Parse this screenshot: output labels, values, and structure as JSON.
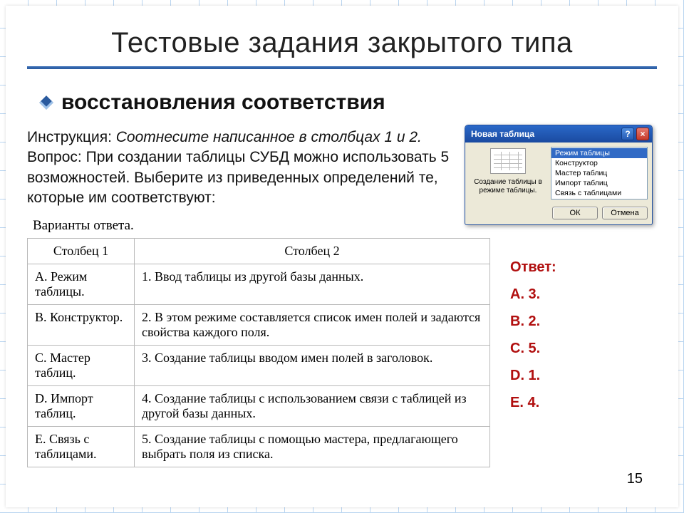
{
  "title": "Тестовые задания закрытого типа",
  "subtitle": "восстановления соответствия",
  "instruction_label": "Инструкция:",
  "instruction_text": "Соотнесите написанное в столбцах 1 и 2.",
  "question_label": "Вопрос:",
  "question_text": "При создании таблицы СУБД можно использовать 5 возможностей. Выберите из приведенных определений те, которые им соответствуют:",
  "variants_label": "Варианты ответа.",
  "table": {
    "head_col1": "Столбец 1",
    "head_col2": "Столбец 2",
    "rows": [
      {
        "c1": "A. Режим таблицы.",
        "c2": "1. Ввод таблицы из другой базы данных."
      },
      {
        "c1": "B. Конструктор.",
        "c2": "2. В этом режиме составляется список имен полей и задаются свойства каждого поля."
      },
      {
        "c1": "C. Мастер таблиц.",
        "c2": "3. Создание таблицы вводом имен полей в заголовок."
      },
      {
        "c1": "D. Импорт таблиц.",
        "c2": "4. Создание таблицы с использованием связи с таблицей из другой базы данных."
      },
      {
        "c1": "E. Связь с таблицами.",
        "c2": "5. Создание таблицы с помощью мастера, предлагающего выбрать поля из списка."
      }
    ]
  },
  "answer_key": {
    "label": "Ответ:",
    "items": [
      "A. 3.",
      "B. 2.",
      "C. 5.",
      "D. 1.",
      "E. 4."
    ]
  },
  "xp_dialog": {
    "title": "Новая таблица",
    "help": "?",
    "close": "×",
    "preview_label": "Создание таблицы в режиме таблицы.",
    "list": [
      {
        "text": "Режим таблицы",
        "selected": true
      },
      {
        "text": "Конструктор",
        "selected": false
      },
      {
        "text": "Мастер таблиц",
        "selected": false
      },
      {
        "text": "Импорт таблиц",
        "selected": false
      },
      {
        "text": "Связь с таблицами",
        "selected": false
      }
    ],
    "ok": "ОК",
    "cancel": "Отмена"
  },
  "page_number": "15"
}
